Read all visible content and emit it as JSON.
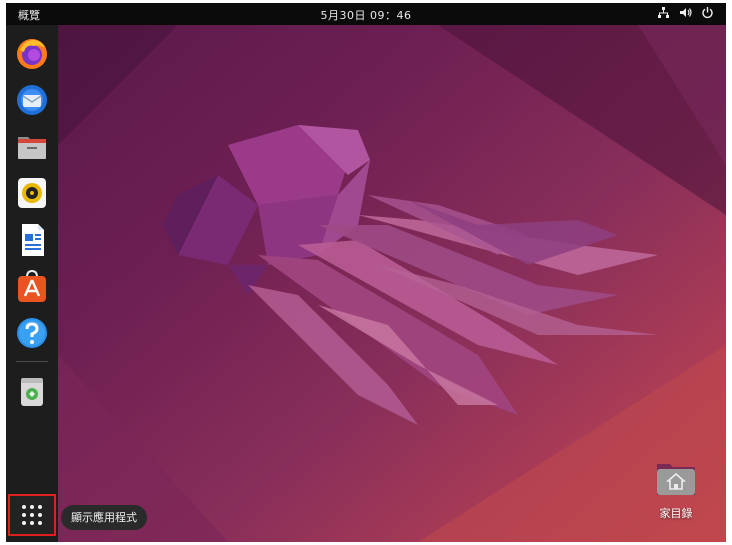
{
  "topbar": {
    "activities_label": "概覽",
    "clock": "5月30日  09：46",
    "tray_icons": [
      "network-icon",
      "volume-icon",
      "power-icon"
    ]
  },
  "dock": {
    "items": [
      {
        "name": "firefox",
        "icon": "firefox-icon"
      },
      {
        "name": "thunderbird",
        "icon": "thunderbird-icon"
      },
      {
        "name": "files",
        "icon": "files-icon"
      },
      {
        "name": "rhythmbox",
        "icon": "rhythmbox-icon"
      },
      {
        "name": "libreoffice-writer",
        "icon": "writer-icon"
      },
      {
        "name": "app-center",
        "icon": "software-icon"
      },
      {
        "name": "help",
        "icon": "help-icon"
      },
      {
        "name": "trash",
        "icon": "trash-icon"
      }
    ],
    "show_apps_tooltip": "顯示應用程式"
  },
  "desktop": {
    "home_folder_label": "家目錄"
  },
  "colors": {
    "accent_highlight": "#e0201c",
    "topbar_bg": "#0b0b0b",
    "dock_bg": "#1d1d1d"
  }
}
